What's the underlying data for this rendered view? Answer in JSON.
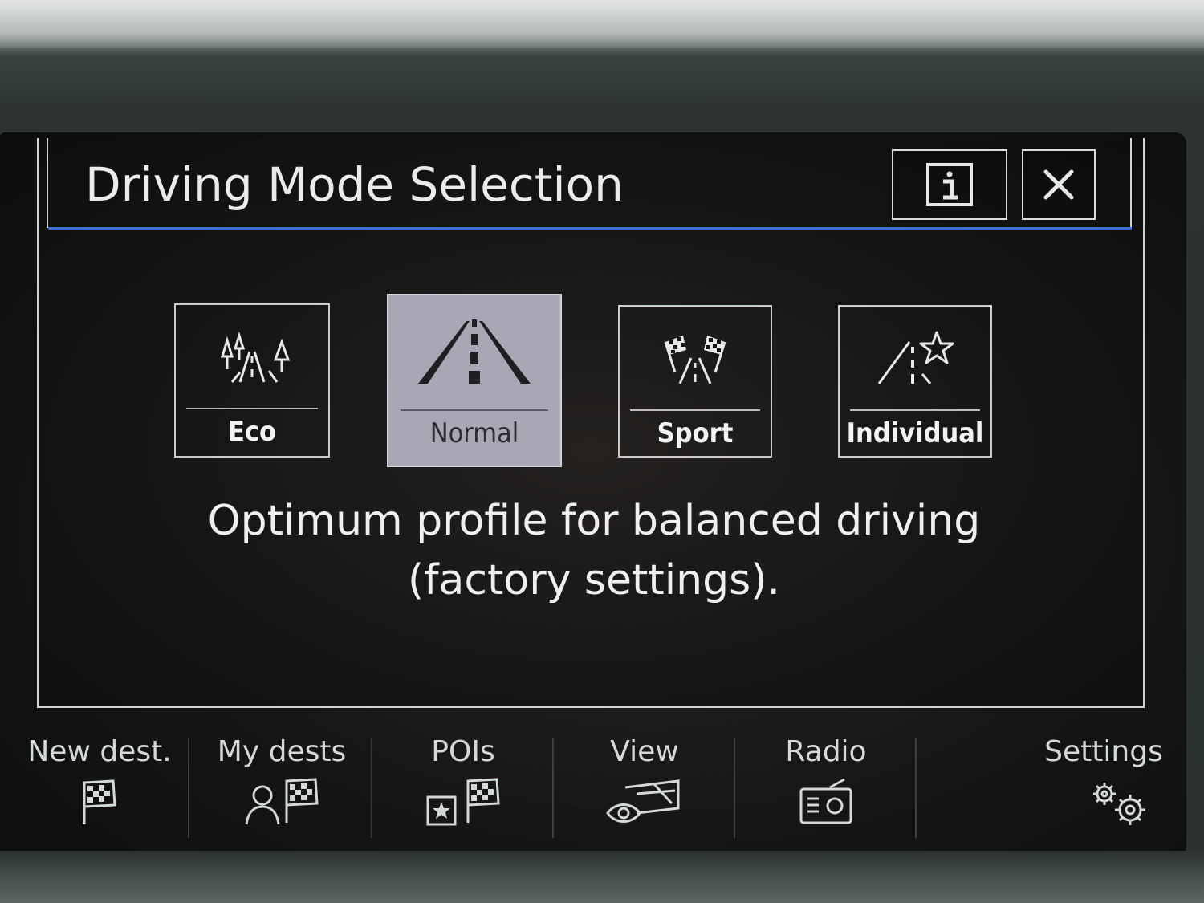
{
  "dialog": {
    "title": "Driving Mode Selection",
    "info_icon": "info-icon",
    "close_icon": "close-icon"
  },
  "modes": [
    {
      "label": "Eco",
      "icon": "eco-trees-road-icon",
      "selected": false
    },
    {
      "label": "Normal",
      "icon": "road-icon",
      "selected": true
    },
    {
      "label": "Sport",
      "icon": "checkered-flags-road-icon",
      "selected": false
    },
    {
      "label": "Individual",
      "icon": "star-road-icon",
      "selected": false
    }
  ],
  "description": {
    "line1": "Optimum profile for balanced driving",
    "line2": "(factory settings)."
  },
  "navbar": {
    "items": [
      {
        "label": "New dest.",
        "icon": "checkered-flag-icon"
      },
      {
        "label": "My dests",
        "icon": "person-flag-icon"
      },
      {
        "label": "POIs",
        "icon": "poi-star-flag-icon"
      },
      {
        "label": "View",
        "icon": "eye-map-icon"
      },
      {
        "label": "Radio",
        "icon": "radio-icon"
      },
      {
        "label": "Settings",
        "icon": "gears-icon"
      }
    ]
  },
  "colors": {
    "accent_rule": "#3a6fd8",
    "selected_tile": "#a9a7b3",
    "text": "#eef0ef",
    "screen_bg": "#141414"
  }
}
